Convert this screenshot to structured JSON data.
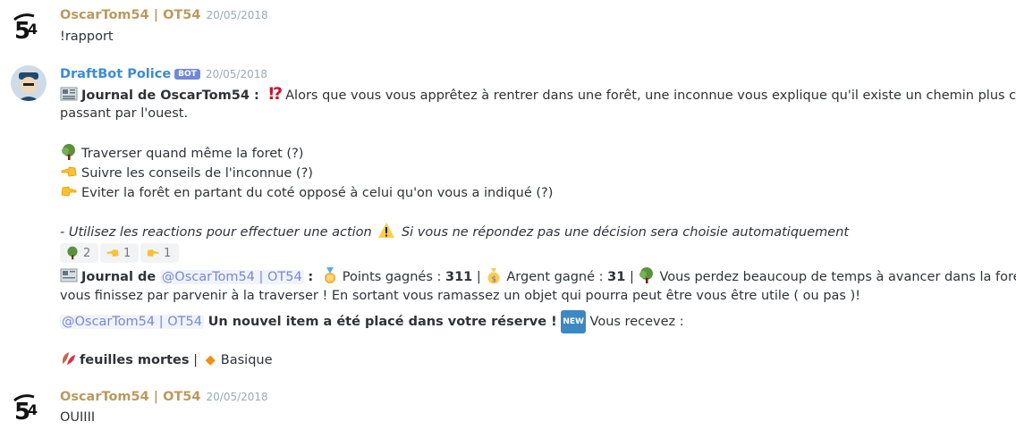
{
  "messages": [
    {
      "author": "OscarTom54 | OT54",
      "timestamp": "20/05/2018",
      "text": "!rapport"
    },
    {
      "author": "DraftBot Police",
      "badge": "BOT",
      "timestamp": "20/05/2018",
      "journal_label": "Journal de ",
      "journal_name": "OscarTom54 :",
      "event_text_line1": "Alors que vous vous apprêtez à rentrer dans une forêt, une inconnue vous explique qu'il existe un chemin plus court en",
      "event_text_line2": "passant par l'ouest.",
      "choices": [
        "Traverser quand même la foret (?)",
        "Suivre les conseils de l'inconnue (?)",
        "Eviter la forêt en partant du coté opposé à celui qu'on vous a indiqué (?)"
      ],
      "instruction_part1": "- Utilisez les reactions pour effectuer une action",
      "instruction_part2": "Si vous ne répondez pas une décision sera choisie automatiquement",
      "reactions": [
        {
          "icon": "tree-icon",
          "count": "2"
        },
        {
          "icon": "point-left-icon",
          "count": "1"
        },
        {
          "icon": "point-right-icon",
          "count": "1"
        }
      ],
      "result": {
        "journal_label": "Journal de",
        "mention": "@OscarTom54 | OT54",
        "colon": ":",
        "points_label": "Points gagnés :",
        "points_value": "311",
        "sep": "|",
        "money_label": "Argent gagné :",
        "money_value": "31",
        "outcome_line1": "Vous perdez beaucoup de temps à avancer dans la foret mais",
        "outcome_line2": "vous finissez par parvenir à la traverser ! En sortant vous ramassez un objet qui pourra peut être vous être utile ( ou pas )!"
      },
      "item_notice": {
        "mention": "@OscarTom54 | OT54",
        "headline": "Un nouvel item a été placé dans votre réserve !",
        "new_badge": "NEW",
        "receive": "Vous recevez :"
      },
      "item": {
        "name": "feuilles mortes",
        "sep": "|",
        "rarity": "Basique"
      }
    },
    {
      "author": "OscarTom54 | OT54",
      "timestamp": "20/05/2018",
      "text": "OUIIII"
    }
  ],
  "colors": {
    "user_name": "#b99a5e",
    "bot_name": "#3b8bd6",
    "mention": "#7289da",
    "bot_badge": "#7289da"
  }
}
